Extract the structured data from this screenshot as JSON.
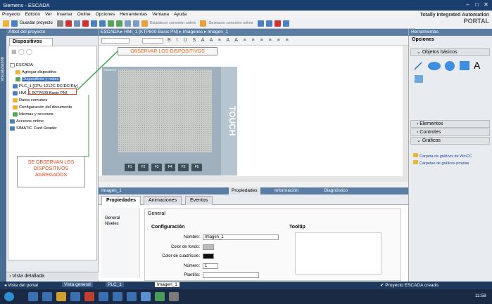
{
  "window": {
    "title": "Siemens - ESCADA"
  },
  "menu": [
    "Proyecto",
    "Edición",
    "Ver",
    "Insertar",
    "Online",
    "Opciones",
    "Herramientas",
    "Ventana",
    "Ayuda"
  ],
  "toolbar": {
    "save_label": "Guardar proyecto",
    "online_label": "Establecer conexión online",
    "offline_label": "Deshacer conexión online"
  },
  "brand": {
    "line1": "Totally Integrated Automation",
    "line2": "PORTAL"
  },
  "left": {
    "vtab": "Visualización",
    "header": "Árbol del proyecto",
    "tab": "Dispositivos",
    "tree": [
      "ESCADA",
      "Agregar dispositivo",
      "Dispositivos y redes",
      "PLC_1 [CPU 1212C DC/DC/Rly]",
      "HMI_1 [KTP600 Basic PN]",
      "Datos comunes",
      "Configuración del documento",
      "Idiomas y recursos",
      "Accesos online",
      "SIMATIC Card Reader"
    ],
    "detail": "Vista detallada"
  },
  "editor": {
    "breadcrumb": "ESCADA ▸ HMI_1 [KTP600 Basic PN] ▸ Imágenes ▸ Imagen_1",
    "touch": "TOUCH",
    "fkeys": [
      "F1",
      "F2",
      "F3",
      "F4",
      "F5",
      "F6"
    ],
    "brandmark": "SIEMENS"
  },
  "annotations": {
    "top": "OBSERVAR LOS DISPOSITIVOS",
    "left": "SE OBSERVAN LOS DISPOSITIVOS AGREGADOS"
  },
  "props": {
    "object": "Imagen_1",
    "tab_props": "Propiedades",
    "tab_info": "Información",
    "tab_diag": "Diagnóstico",
    "tabs": [
      "Propiedades",
      "Animaciones",
      "Eventos"
    ],
    "nav": [
      "General",
      "Niveles"
    ],
    "general": "General",
    "config": "Configuración",
    "tooltip": "Tooltip",
    "fields": {
      "name_label": "Nombre:",
      "name_value": "Imagen_1",
      "bg_label": "Color de fondo:",
      "grid_label": "Color de cuadrícule:",
      "num_label": "Número:",
      "num_value": "1",
      "tpl_label": "Plantilla:"
    }
  },
  "right": {
    "header": "Herramientas",
    "options": "Opciones",
    "basic": "Objetos básicos",
    "text_tool": "A",
    "elements": "Elementos",
    "controls": "Controles",
    "graphics": "Gráficos",
    "graph_items": [
      "Carpeta de gráficos de WinCC",
      "Carpetas de gráficos propias"
    ]
  },
  "status": {
    "portal": "Vista del portal",
    "tabs": [
      "Vista general",
      "PLC_1",
      "Imagen_1"
    ],
    "msg": "Proyecto ESCADA creado."
  },
  "clock": "11:58",
  "colors": {
    "accent": "#1a3e6e",
    "annot": "#e8431e",
    "panel": "#5b7da3"
  }
}
